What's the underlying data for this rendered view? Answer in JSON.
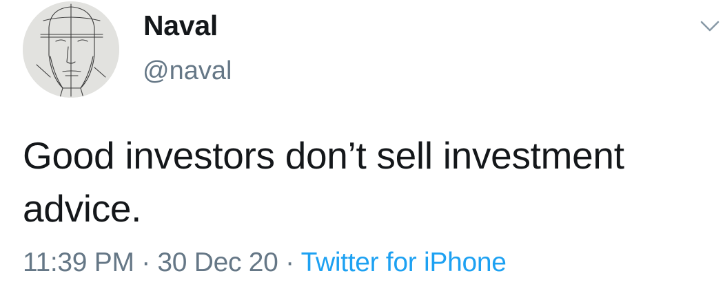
{
  "tweet": {
    "author": {
      "display_name": "Naval",
      "handle": "@naval",
      "avatar_icon": "sketched-face-avatar"
    },
    "text": "Good investors don’t sell investment advice.",
    "time": "11:39 PM",
    "separator": "·",
    "date": "30 Dec 20",
    "source": "Twitter for iPhone",
    "menu_icon": "chevron-down-icon"
  },
  "colors": {
    "text_primary": "#14171a",
    "text_secondary": "#657786",
    "link": "#1da1f2",
    "chevron": "#8899a6"
  }
}
